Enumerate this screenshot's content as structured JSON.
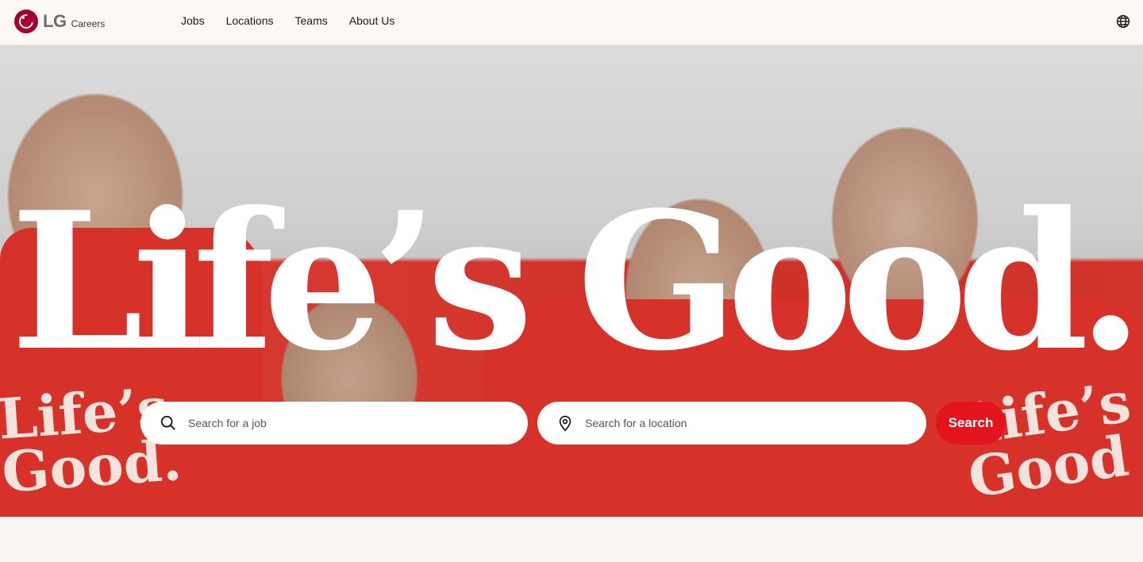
{
  "brand": {
    "logo_text": "LG",
    "subtitle": "Careers",
    "color": "#a50034"
  },
  "nav": {
    "items": [
      {
        "label": "Jobs"
      },
      {
        "label": "Locations"
      },
      {
        "label": "Teams"
      },
      {
        "label": "About Us"
      }
    ],
    "language_icon": "globe-icon"
  },
  "hero": {
    "title": "Life’s Good.",
    "shirt_text_left": "Life’s Good.",
    "shirt_text_right": "Life’s Good"
  },
  "search": {
    "job_placeholder": "Search for a job",
    "location_placeholder": "Search for a location",
    "button_label": "Search",
    "button_color": "#e3141d",
    "job_icon": "search-icon",
    "location_icon": "location-pin-icon"
  }
}
